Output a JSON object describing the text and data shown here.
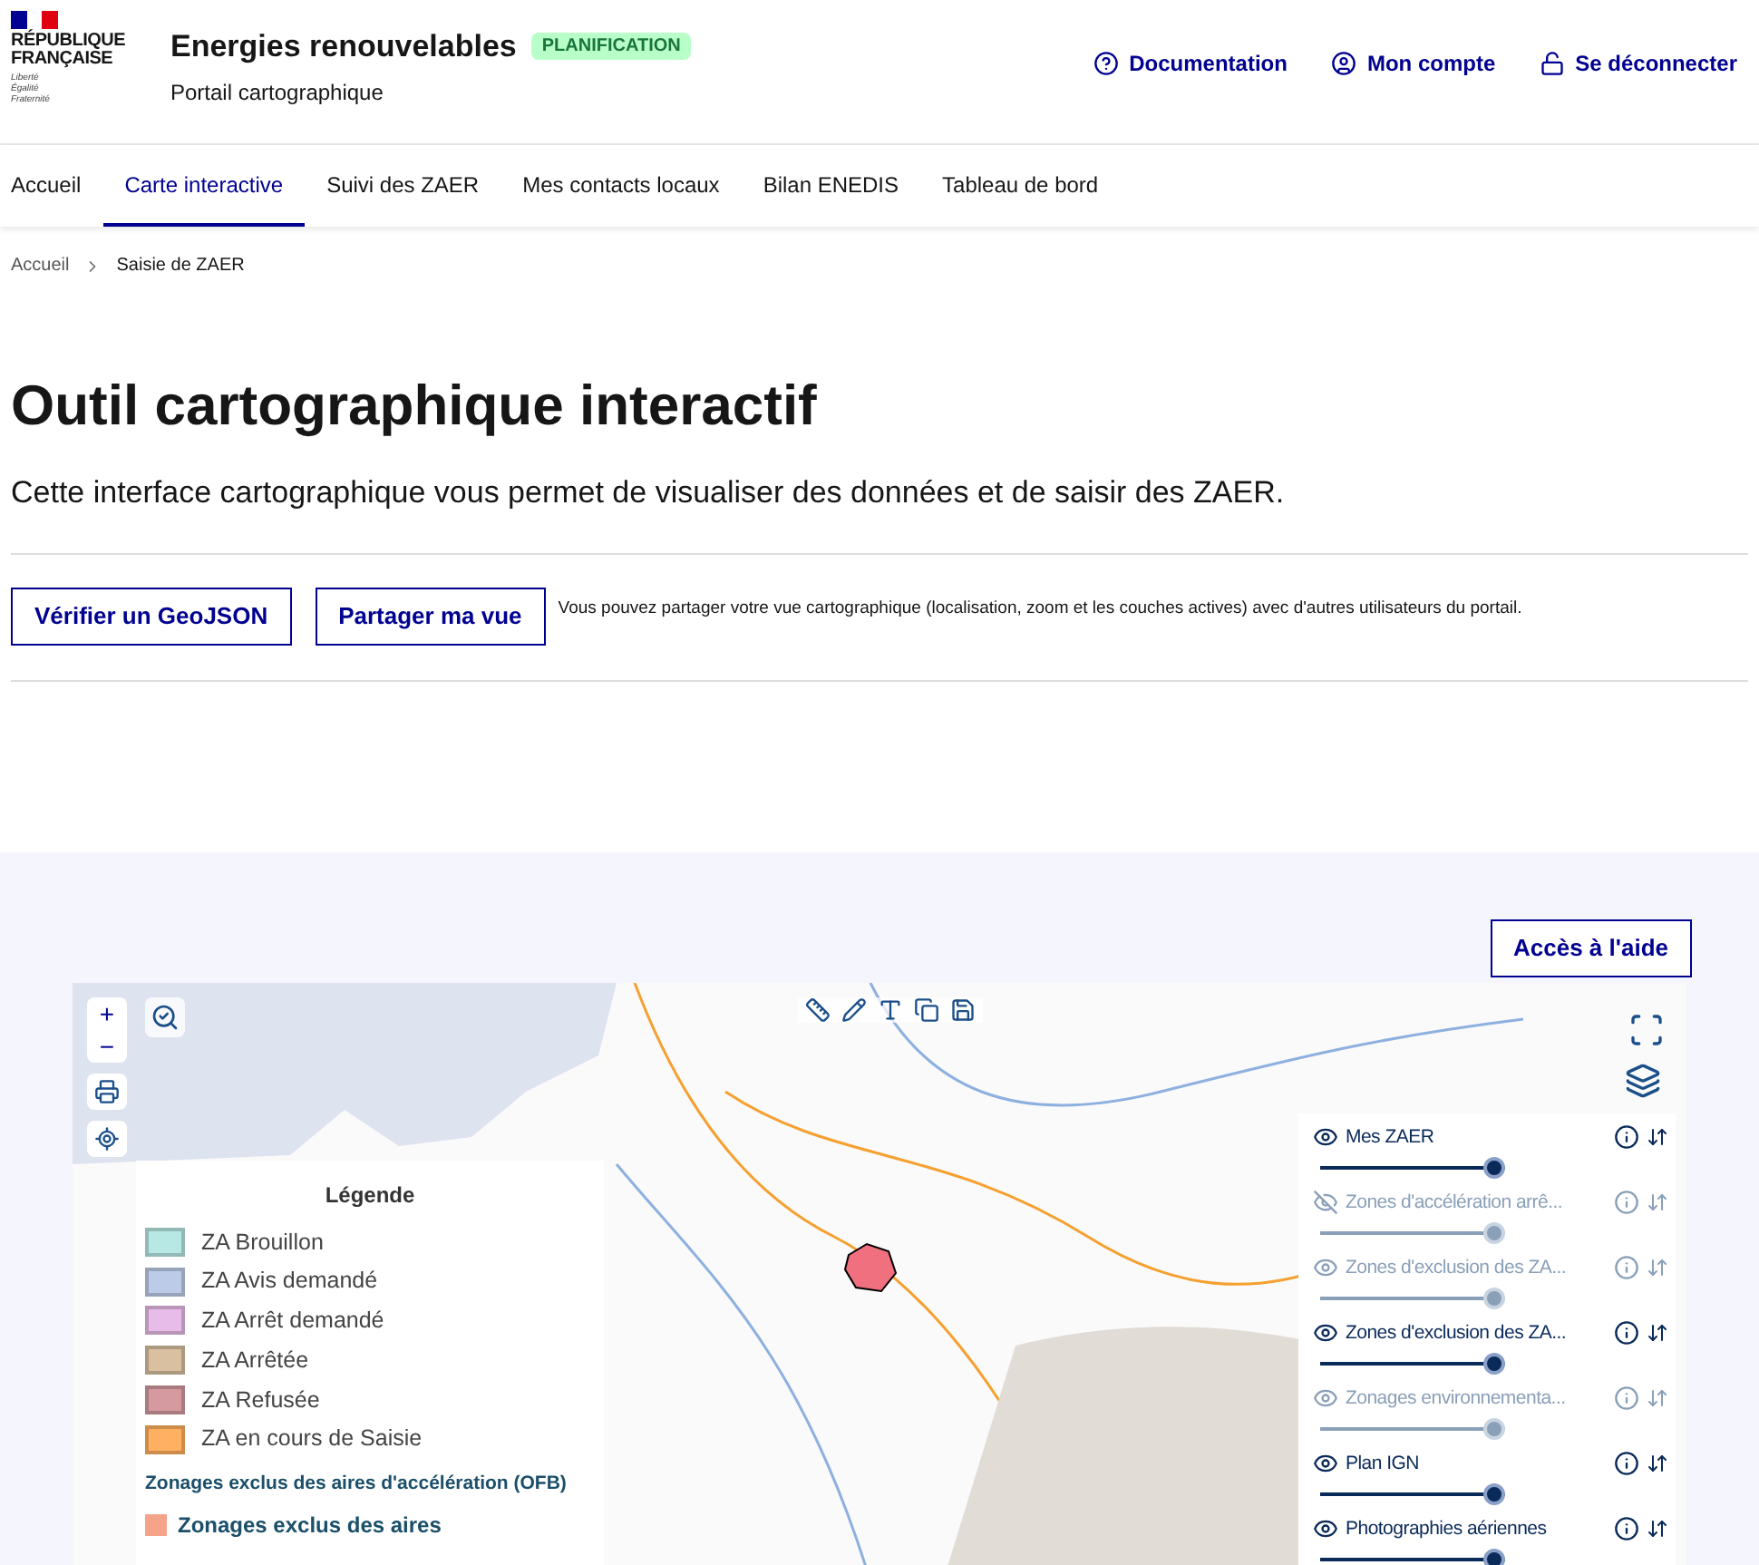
{
  "header": {
    "logo": {
      "line1": "RÉPUBLIQUE",
      "line2": "FRANÇAISE",
      "motto": [
        "Liberté",
        "Égalité",
        "Fraternité"
      ]
    },
    "title": "Energies renouvelables",
    "badge": "PLANIFICATION",
    "subtitle": "Portail cartographique",
    "links": [
      {
        "kind": "help",
        "label": "Documentation"
      },
      {
        "kind": "account",
        "label": "Mon compte"
      },
      {
        "kind": "logout",
        "label": "Se déconnecter"
      }
    ]
  },
  "nav": [
    {
      "label": "Accueil",
      "selected": false
    },
    {
      "label": "Carte interactive",
      "selected": true
    },
    {
      "label": "Suivi des ZAER",
      "selected": false
    },
    {
      "label": "Mes contacts locaux",
      "selected": false
    },
    {
      "label": "Bilan ENEDIS",
      "selected": false
    },
    {
      "label": "Tableau de bord",
      "selected": false
    }
  ],
  "breadcrumb": [
    "Accueil",
    "Saisie de ZAER"
  ],
  "page": {
    "title": "Outil cartographique interactif",
    "lead": "Cette interface cartographique vous permet de visualiser des données et de saisir des ZAER."
  },
  "actions": {
    "buttons": [
      "Vérifier un GeoJSON",
      "Partager ma vue"
    ],
    "note": "Vous pouvez partager votre vue cartographique (localisation, zoom et les couches actives) avec d'autres utilisateurs du portail."
  },
  "map": {
    "help_button": "Accès à l'aide",
    "zoom": {
      "in": "+",
      "out": "−"
    },
    "legend": {
      "title": "Légende",
      "items": [
        {
          "label": "ZA Brouillon",
          "color": "#b8e8e4"
        },
        {
          "label": "ZA Avis demandé",
          "color": "#bccce8"
        },
        {
          "label": "ZA Arrêt demandé",
          "color": "#e8bce8"
        },
        {
          "label": "ZA Arrêtée",
          "color": "#d9c0a0"
        },
        {
          "label": "ZA Refusée",
          "color": "#d49aa0"
        },
        {
          "label": "ZA en cours de Saisie",
          "color": "#ffb060"
        }
      ],
      "section": "Zonages exclus des aires d'accélération (OFB)",
      "section_items": [
        {
          "label": "Zonages exclus des aires",
          "color": "#f5a48a"
        }
      ]
    },
    "layers": [
      {
        "name": "Mes ZAER",
        "visible": true,
        "disabled": false,
        "level": 1
      },
      {
        "name": "Zones d'accélération arrê...",
        "visible": false,
        "disabled": true,
        "level": 1
      },
      {
        "name": "Zones d'exclusion des ZA...",
        "visible": true,
        "disabled": true,
        "level": 1
      },
      {
        "name": "Zones d'exclusion des ZA...",
        "visible": true,
        "disabled": false,
        "level": 1
      },
      {
        "name": "Zonages environnementa...",
        "visible": true,
        "disabled": true,
        "level": 1
      },
      {
        "name": "Plan IGN",
        "visible": true,
        "disabled": false,
        "level": 1
      },
      {
        "name": "Photographies aériennes",
        "visible": true,
        "disabled": false,
        "level": 1
      }
    ]
  }
}
